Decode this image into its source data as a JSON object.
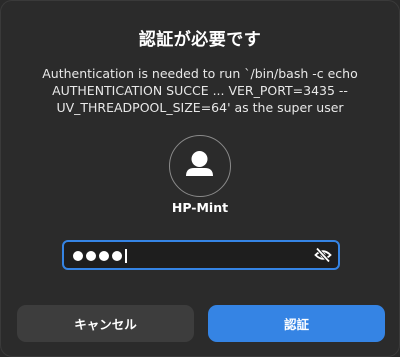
{
  "dialog": {
    "title": "認証が必要です",
    "message_lines": [
      "Authentication is needed to run `/bin/bash -c echo",
      "AUTHENTICATION SUCCE ... VER_PORT=3435 --",
      "UV_THREADPOOL_SIZE=64' as the super user"
    ],
    "user": {
      "icon": "user-avatar-icon",
      "name": "HP-Mint"
    },
    "password": {
      "masked_char_count": 4,
      "toggle_icon": "eye-slash-icon"
    },
    "buttons": {
      "cancel_label": "キャンセル",
      "authenticate_label": "認証"
    },
    "colors": {
      "background": "#2b2b2b",
      "accent": "#3584e4",
      "secondary_button": "#3d3d3d"
    }
  }
}
